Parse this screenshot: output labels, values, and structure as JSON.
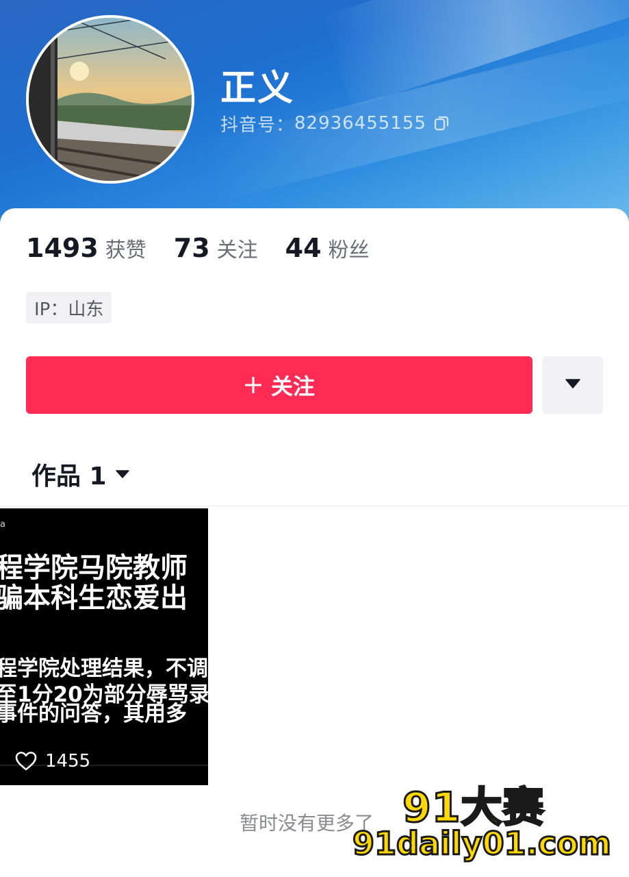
{
  "profile": {
    "nickname": "正义",
    "douyin_id_label": "抖音号：",
    "douyin_id": "82936455155"
  },
  "stats": [
    {
      "value": "1493",
      "label": "获赞"
    },
    {
      "value": "73",
      "label": "关注"
    },
    {
      "value": "44",
      "label": "粉丝"
    }
  ],
  "ip_tag": "IP：山东",
  "actions": {
    "follow_label": "关注",
    "more_icon": "caret-down-icon"
  },
  "tabs": {
    "works_label": "作品 1"
  },
  "videos": [
    {
      "corner_text": "a",
      "title_lines": [
        "程学院马院教师",
        "骗本科生恋爱出"
      ],
      "body_lines": [
        "程学院处理结果，不调",
        "至1分20为部分辱骂录",
        "事件的问答，其用多"
      ],
      "likes": "1455"
    }
  ],
  "footer": {
    "end_text": "暂时没有更多了"
  },
  "watermark": {
    "line1": "91大赛",
    "line2": "91daily01.com"
  },
  "colors": {
    "follow_button": "#fe2c55",
    "header_gradient_start": "#2a67c2",
    "header_gradient_end": "#6cbdee",
    "watermark": "#ffd800"
  }
}
